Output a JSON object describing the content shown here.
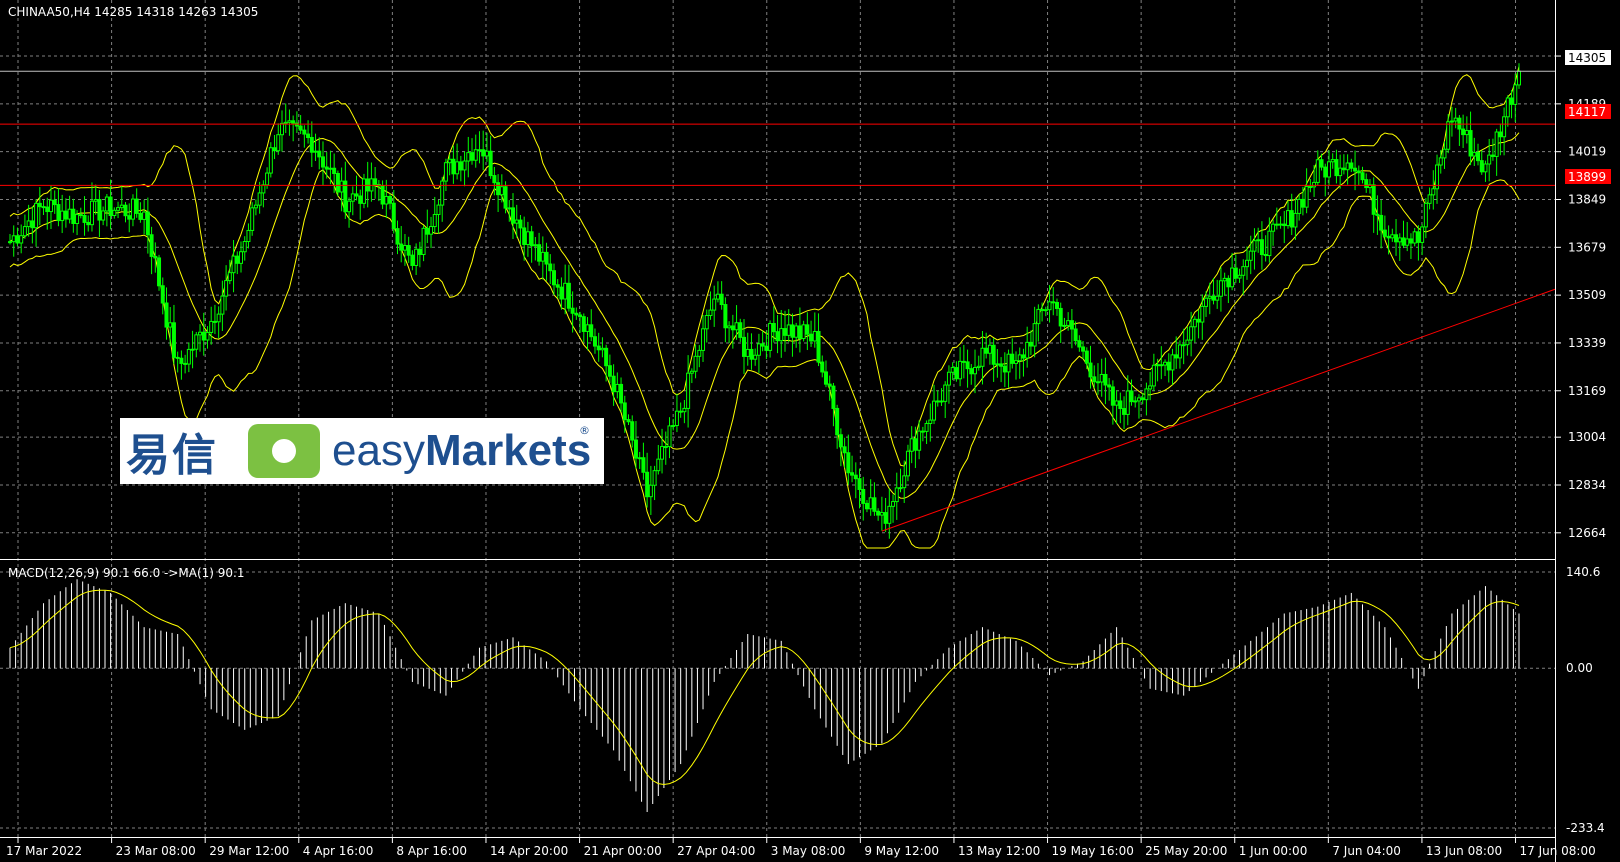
{
  "header": {
    "symbol_info": "CHINAA50,H4  14285 14318 14263 14305",
    "indicator_info": "MACD(12,26,9) 90.1 66.0  ->MA(1) 90.1"
  },
  "price_axis": [
    "14359",
    "14189",
    "14019",
    "13849",
    "13679",
    "13509",
    "13339",
    "13169",
    "13004",
    "12834",
    "12664"
  ],
  "macd_axis": [
    "140.6",
    "0.00",
    "-233.4"
  ],
  "price_markers": {
    "current": "14305",
    "resistance_1": "14117",
    "resistance_2": "13899"
  },
  "time_axis": [
    "17 Mar 2022",
    "23 Mar 08:00",
    "29 Mar 12:00",
    "4 Apr 16:00",
    "8 Apr 16:00",
    "14 Apr 20:00",
    "21 Apr 00:00",
    "27 Apr 04:00",
    "3 May 08:00",
    "9 May 12:00",
    "13 May 12:00",
    "19 May 16:00",
    "25 May 20:00",
    "1 Jun 00:00",
    "7 Jun 04:00",
    "13 Jun 08:00",
    "17 Jun 08:00"
  ],
  "logo": {
    "cn": "易信",
    "en_light": "easy",
    "en_bold": "Markets",
    "reg": "®"
  },
  "colors": {
    "candle": "#00ff00",
    "bands": "#ffff00",
    "line_red": "#ff0000",
    "grid": "#7f7f7f",
    "histogram": "#ffffff",
    "signal": "#ffff00"
  },
  "chart_data": {
    "type": "candlestick",
    "symbol": "CHINAA50",
    "timeframe": "H4",
    "last_bar": {
      "open": 14285,
      "high": 14318,
      "low": 14263,
      "close": 14305
    },
    "price_ylim": [
      12610,
      14480
    ],
    "close_path": [
      {
        "x": "17 Mar 2022",
        "y": 13700
      },
      {
        "x": "19 Mar",
        "y": 13830
      },
      {
        "x": "21 Mar",
        "y": 13790
      },
      {
        "x": "23 Mar 08:00",
        "y": 13820
      },
      {
        "x": "25 Mar",
        "y": 13800
      },
      {
        "x": "27 Mar",
        "y": 13250
      },
      {
        "x": "29 Mar 12:00",
        "y": 13420
      },
      {
        "x": "31 Mar",
        "y": 13700
      },
      {
        "x": "2 Apr",
        "y": 14100
      },
      {
        "x": "4 Apr 16:00",
        "y": 14060
      },
      {
        "x": "6 Apr",
        "y": 13850
      },
      {
        "x": "8 Apr 16:00",
        "y": 13900
      },
      {
        "x": "10 Apr",
        "y": 13600
      },
      {
        "x": "12 Apr",
        "y": 13950
      },
      {
        "x": "14 Apr 20:00",
        "y": 14050
      },
      {
        "x": "16 Apr",
        "y": 13800
      },
      {
        "x": "19 Apr",
        "y": 13600
      },
      {
        "x": "21 Apr 00:00",
        "y": 13450
      },
      {
        "x": "23 Apr",
        "y": 13200
      },
      {
        "x": "25 Apr",
        "y": 12800
      },
      {
        "x": "27 Apr 04:00",
        "y": 13100
      },
      {
        "x": "29 Apr",
        "y": 13500
      },
      {
        "x": "1 May",
        "y": 13300
      },
      {
        "x": "3 May 08:00",
        "y": 13400
      },
      {
        "x": "5 May",
        "y": 13350
      },
      {
        "x": "7 May",
        "y": 12900
      },
      {
        "x": "9 May 12:00",
        "y": 12700
      },
      {
        "x": "11 May",
        "y": 13000
      },
      {
        "x": "13 May 12:00",
        "y": 13200
      },
      {
        "x": "15 May",
        "y": 13300
      },
      {
        "x": "17 May",
        "y": 13250
      },
      {
        "x": "19 May 16:00",
        "y": 13500
      },
      {
        "x": "21 May",
        "y": 13300
      },
      {
        "x": "23 May",
        "y": 13100
      },
      {
        "x": "25 May 20:00",
        "y": 13200
      },
      {
        "x": "28 May",
        "y": 13350
      },
      {
        "x": "1 Jun 00:00",
        "y": 13550
      },
      {
        "x": "3 Jun",
        "y": 13650
      },
      {
        "x": "5 Jun",
        "y": 13750
      },
      {
        "x": "7 Jun 04:00",
        "y": 13950
      },
      {
        "x": "9 Jun",
        "y": 14000
      },
      {
        "x": "11 Jun",
        "y": 13750
      },
      {
        "x": "13 Jun 08:00",
        "y": 13700
      },
      {
        "x": "15 Jun",
        "y": 14150
      },
      {
        "x": "16 Jun",
        "y": 13950
      },
      {
        "x": "17 Jun 08:00",
        "y": 14305
      }
    ],
    "horizontal_lines": [
      14305,
      14117,
      13899
    ],
    "trendline": {
      "from": {
        "x": "9 May 12:00",
        "y": 12670
      },
      "to": {
        "x": "17 Jun 08:00",
        "y": 13530
      }
    },
    "macd": {
      "ylim": [
        -233.4,
        140.6
      ],
      "values": [
        30,
        95,
        130,
        110,
        60,
        50,
        -60,
        -90,
        -70,
        70,
        95,
        80,
        -20,
        -40,
        30,
        45,
        10,
        -60,
        -120,
        -210,
        -140,
        -20,
        50,
        40,
        -60,
        -140,
        -110,
        -20,
        30,
        60,
        40,
        -10,
        10,
        60,
        -30,
        -40,
        0,
        40,
        80,
        90,
        110,
        60,
        -30,
        80,
        120,
        80
      ]
    }
  }
}
